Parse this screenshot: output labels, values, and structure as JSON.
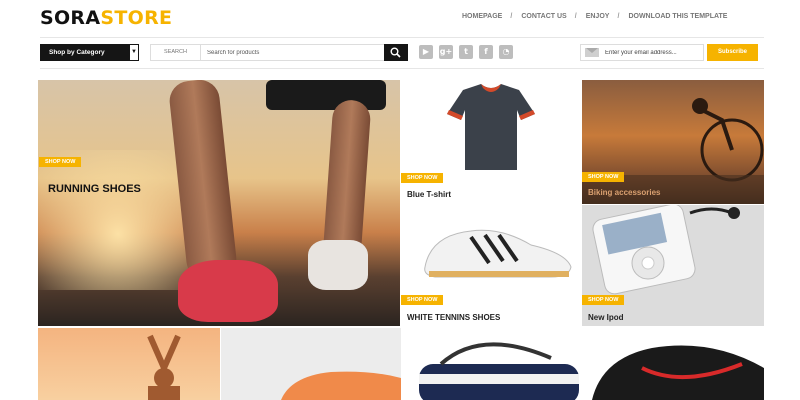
{
  "logo": {
    "part1": "SORA",
    "part2": "STORE"
  },
  "nav": [
    "HOMEPAGE",
    "CONTACT US",
    "ENJOY",
    "DOWNLOAD THIS TEMPLATE"
  ],
  "toolbar": {
    "category_label": "Shop by Category",
    "search_label": "SEARCH",
    "search_placeholder": "Search for products",
    "email_placeholder": "Enter your email address...",
    "subscribe_label": "Subscribe"
  },
  "social": [
    {
      "icon": "youtube-icon",
      "glyph": "▶"
    },
    {
      "icon": "google-plus-icon",
      "glyph": "g+"
    },
    {
      "icon": "twitter-icon",
      "glyph": "t"
    },
    {
      "icon": "facebook-icon",
      "glyph": "f"
    },
    {
      "icon": "rss-icon",
      "glyph": "◔"
    }
  ],
  "tiles": {
    "shop_now": "SHOP NOW",
    "running": "RUNNING SHOES",
    "tshirt": "Blue T-shirt",
    "accessories": "Biking accessories",
    "white_shoes": "WHITE TENNINS SHOES",
    "ipod": "New Ipod"
  },
  "colors": {
    "accent": "#f6b300",
    "dark": "#151515"
  }
}
